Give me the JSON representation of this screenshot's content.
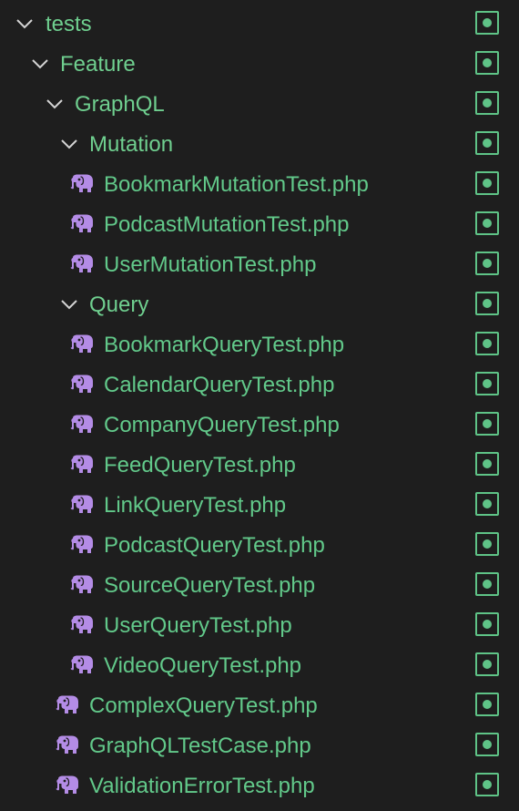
{
  "theme": {
    "folder_text_color": "#6fcf8f",
    "file_text_color": "#62c98a",
    "status_color": "#5fc487",
    "php_icon_color": "#b48ce6",
    "background": "#1e1e1e"
  },
  "tree": {
    "tests": {
      "label": "tests",
      "expanded": true
    },
    "feature": {
      "label": "Feature",
      "expanded": true
    },
    "graphql": {
      "label": "GraphQL",
      "expanded": true
    },
    "mutation": {
      "label": "Mutation",
      "expanded": true
    },
    "mutation_files": [
      {
        "label": "BookmarkMutationTest.php",
        "icon": "php-elephant-icon"
      },
      {
        "label": "PodcastMutationTest.php",
        "icon": "php-elephant-icon"
      },
      {
        "label": "UserMutationTest.php",
        "icon": "php-elephant-icon"
      }
    ],
    "query": {
      "label": "Query",
      "expanded": true
    },
    "query_files": [
      {
        "label": "BookmarkQueryTest.php",
        "icon": "php-elephant-icon"
      },
      {
        "label": "CalendarQueryTest.php",
        "icon": "php-elephant-icon"
      },
      {
        "label": "CompanyQueryTest.php",
        "icon": "php-elephant-icon"
      },
      {
        "label": "FeedQueryTest.php",
        "icon": "php-elephant-icon"
      },
      {
        "label": "LinkQueryTest.php",
        "icon": "php-elephant-icon"
      },
      {
        "label": "PodcastQueryTest.php",
        "icon": "php-elephant-icon"
      },
      {
        "label": "SourceQueryTest.php",
        "icon": "php-elephant-icon"
      },
      {
        "label": "UserQueryTest.php",
        "icon": "php-elephant-icon"
      },
      {
        "label": "VideoQueryTest.php",
        "icon": "php-elephant-icon"
      }
    ],
    "graphql_files": [
      {
        "label": "ComplexQueryTest.php",
        "icon": "php-elephant-icon"
      },
      {
        "label": "GraphQLTestCase.php",
        "icon": "php-elephant-icon"
      },
      {
        "label": "ValidationErrorTest.php",
        "icon": "php-elephant-icon"
      }
    ]
  }
}
